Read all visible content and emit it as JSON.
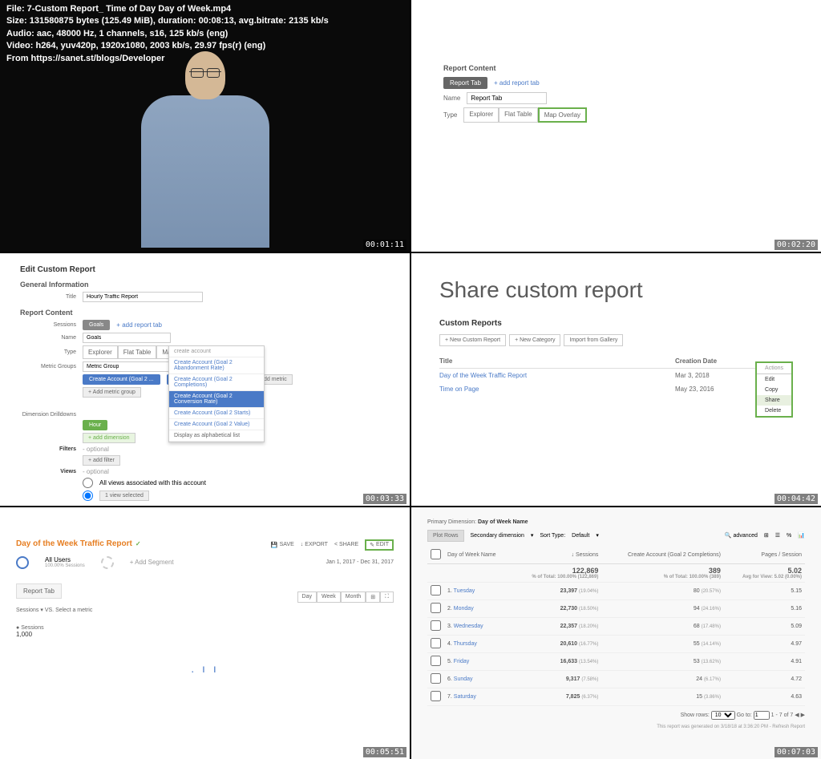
{
  "meta": {
    "line1": "File: 7-Custom Report_ Time of Day Day of Week.mp4",
    "line2": "Size: 131580875 bytes (125.49 MiB), duration: 00:08:13, avg.bitrate: 2135 kb/s",
    "line3": "Audio: aac, 48000 Hz, 1 channels, s16, 125 kb/s (eng)",
    "line4": "Video: h264, yuv420p, 1920x1080, 2003 kb/s, 29.97 fps(r) (eng)",
    "line5": "From https://sanet.st/blogs/Developer"
  },
  "timestamps": [
    "00:01:11",
    "00:02:20",
    "00:03:33",
    "00:04:42",
    "00:05:51",
    "00:07:03"
  ],
  "cell2": {
    "title": "Report Content",
    "tab": "Report Tab",
    "add_tab": "+ add report tab",
    "name_label": "Name",
    "name_value": "Report Tab",
    "type_label": "Type",
    "types": [
      "Explorer",
      "Flat Table",
      "Map Overlay"
    ]
  },
  "cell3": {
    "title": "Edit Custom Report",
    "gen_info": "General Information",
    "title_label": "Title",
    "title_value": "Hourly Traffic Report",
    "rc": "Report Content",
    "sessions": "Sessions",
    "goals": "Goals",
    "add_tab": "+ add report tab",
    "name_label": "Name",
    "name_value": "Goals",
    "type_label": "Type",
    "types": [
      "Explorer",
      "Flat Table",
      "Map Overlay"
    ],
    "metric_label": "Metric Groups",
    "metric_group": "Metric Group",
    "m1": "Create Account (Goal 2 ...",
    "m2": "Create Account (Goal 2 ...",
    "add_metric": "+ add metric",
    "add_group": "+ Add metric group",
    "dd_label": "create account",
    "dd_items": [
      "Create Account (Goal 2 Abandonment Rate)",
      "Create Account (Goal 2 Completions)",
      "Create Account (Goal 2 Conversion Rate)",
      "Create Account (Goal 2 Starts)",
      "Create Account (Goal 2 Value)"
    ],
    "dd_footer": "Display as alphabetical list",
    "dim_label": "Dimension Drilldowns",
    "hour": "Hour",
    "add_dim": "+ add dimension",
    "filters": "Filters",
    "optional": "- optional",
    "add_filter": "+ add filter",
    "views": "Views",
    "views_all": "All views associated with this account",
    "views_sel": "1 view selected"
  },
  "cell4": {
    "title": "Share custom report",
    "sub": "Custom Reports",
    "btn1": "+ New Custom Report",
    "btn2": "+ New Category",
    "btn3": "Import from Gallery",
    "col1": "Title",
    "col2": "Creation Date",
    "r1_title": "Day of the Week Traffic Report",
    "r1_date": "Mar 3, 2018",
    "r2_title": "Time on Page",
    "r2_date": "May 23, 2016",
    "actions_label": "Actions",
    "actions": [
      "Edit",
      "Copy",
      "Share",
      "Delete"
    ]
  },
  "cell5": {
    "title": "Day of the Week Traffic Report",
    "save": "SAVE",
    "export": "EXPORT",
    "share": "SHARE",
    "edit": "EDIT",
    "all_users": "All Users",
    "all_users_sub": "100.00% Sessions",
    "add_segment": "+ Add Segment",
    "date_range": "Jan 1, 2017 - Dec 31, 2017",
    "tab": "Report Tab",
    "sessions_by": "Sessions",
    "vs": "VS.",
    "select_metric": "Select a metric",
    "view_day": "Day",
    "view_week": "Week",
    "view_month": "Month",
    "sessions_label": "Sessions",
    "sessions_val": "1,000"
  },
  "cell6": {
    "primary_dim": "Primary Dimension:",
    "dim_name": "Day of Week Name",
    "plot_rows": "Plot Rows",
    "sec_dim": "Secondary dimension",
    "sort_type": "Sort Type:",
    "default": "Default",
    "advanced": "advanced",
    "col_day": "Day of Week Name",
    "col_sessions": "Sessions",
    "col_create": "Create Account (Goal 2 Completions)",
    "col_pages": "Pages / Session",
    "totals": {
      "sessions": "122,869",
      "sessions_sub": "% of Total: 100.00% (122,869)",
      "create": "389",
      "create_sub": "% of Total: 100.00% (389)",
      "pages": "5.02",
      "pages_sub": "Avg for View: 5.02 (0.00%)"
    },
    "rows": [
      {
        "n": "1.",
        "day": "Tuesday",
        "s": "23,397",
        "sp": "(19.04%)",
        "c": "80",
        "cp": "(20.57%)",
        "p": "5.15"
      },
      {
        "n": "2.",
        "day": "Monday",
        "s": "22,730",
        "sp": "(18.50%)",
        "c": "94",
        "cp": "(24.16%)",
        "p": "5.16"
      },
      {
        "n": "3.",
        "day": "Wednesday",
        "s": "22,357",
        "sp": "(18.20%)",
        "c": "68",
        "cp": "(17.48%)",
        "p": "5.09"
      },
      {
        "n": "4.",
        "day": "Thursday",
        "s": "20,610",
        "sp": "(16.77%)",
        "c": "55",
        "cp": "(14.14%)",
        "p": "4.97"
      },
      {
        "n": "5.",
        "day": "Friday",
        "s": "16,633",
        "sp": "(13.54%)",
        "c": "53",
        "cp": "(13.62%)",
        "p": "4.91"
      },
      {
        "n": "6.",
        "day": "Sunday",
        "s": "9,317",
        "sp": "(7.58%)",
        "c": "24",
        "cp": "(6.17%)",
        "p": "4.72"
      },
      {
        "n": "7.",
        "day": "Saturday",
        "s": "7,825",
        "sp": "(6.37%)",
        "c": "15",
        "cp": "(3.86%)",
        "p": "4.63"
      }
    ],
    "show_rows": "Show rows:",
    "show_rows_val": "10",
    "goto": "Go to:",
    "goto_val": "1",
    "pagination": "1 - 7 of 7",
    "footer": "This report was generated on 3/18/18 at 3:36:20 PM - Refresh Report"
  }
}
